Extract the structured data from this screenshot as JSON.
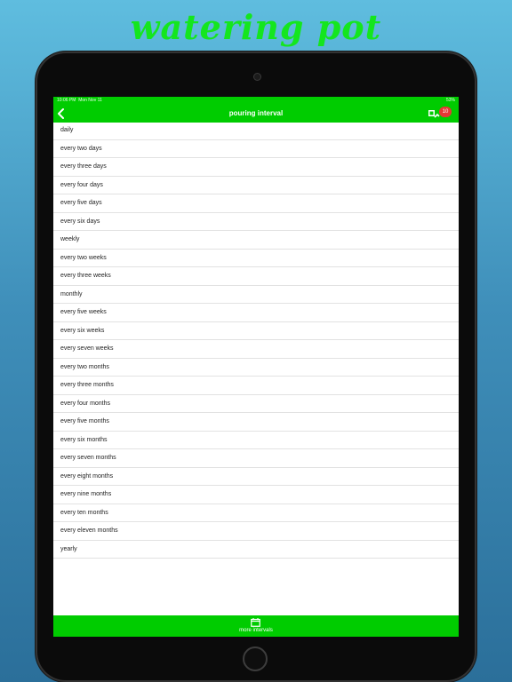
{
  "banner": {
    "title": "watering pot"
  },
  "status": {
    "time": "10:06 PM",
    "date": "Mon Nov 11",
    "right": "53%"
  },
  "nav": {
    "title": "pouring interval",
    "badge": "10"
  },
  "intervals": [
    "daily",
    "every two days",
    "every three days",
    "every four days",
    "every five days",
    "every six days",
    "weekly",
    "every two weeks",
    "every three weeks",
    "monthly",
    "every five weeks",
    "every six weeks",
    "every seven weeks",
    "every two months",
    "every three months",
    "every four months",
    "every five months",
    "every six months",
    "every seven months",
    "every eight months",
    "every nine months",
    "every ten months",
    "every eleven months",
    "yearly"
  ],
  "bottom": {
    "label": "more intervals"
  },
  "colors": {
    "accent": "#00cc00",
    "title": "#14e61e",
    "badge": "#e53935"
  },
  "icons": {
    "back": "chevron-left-icon",
    "plant": "plant-pot-icon",
    "more": "calendar-icon"
  }
}
